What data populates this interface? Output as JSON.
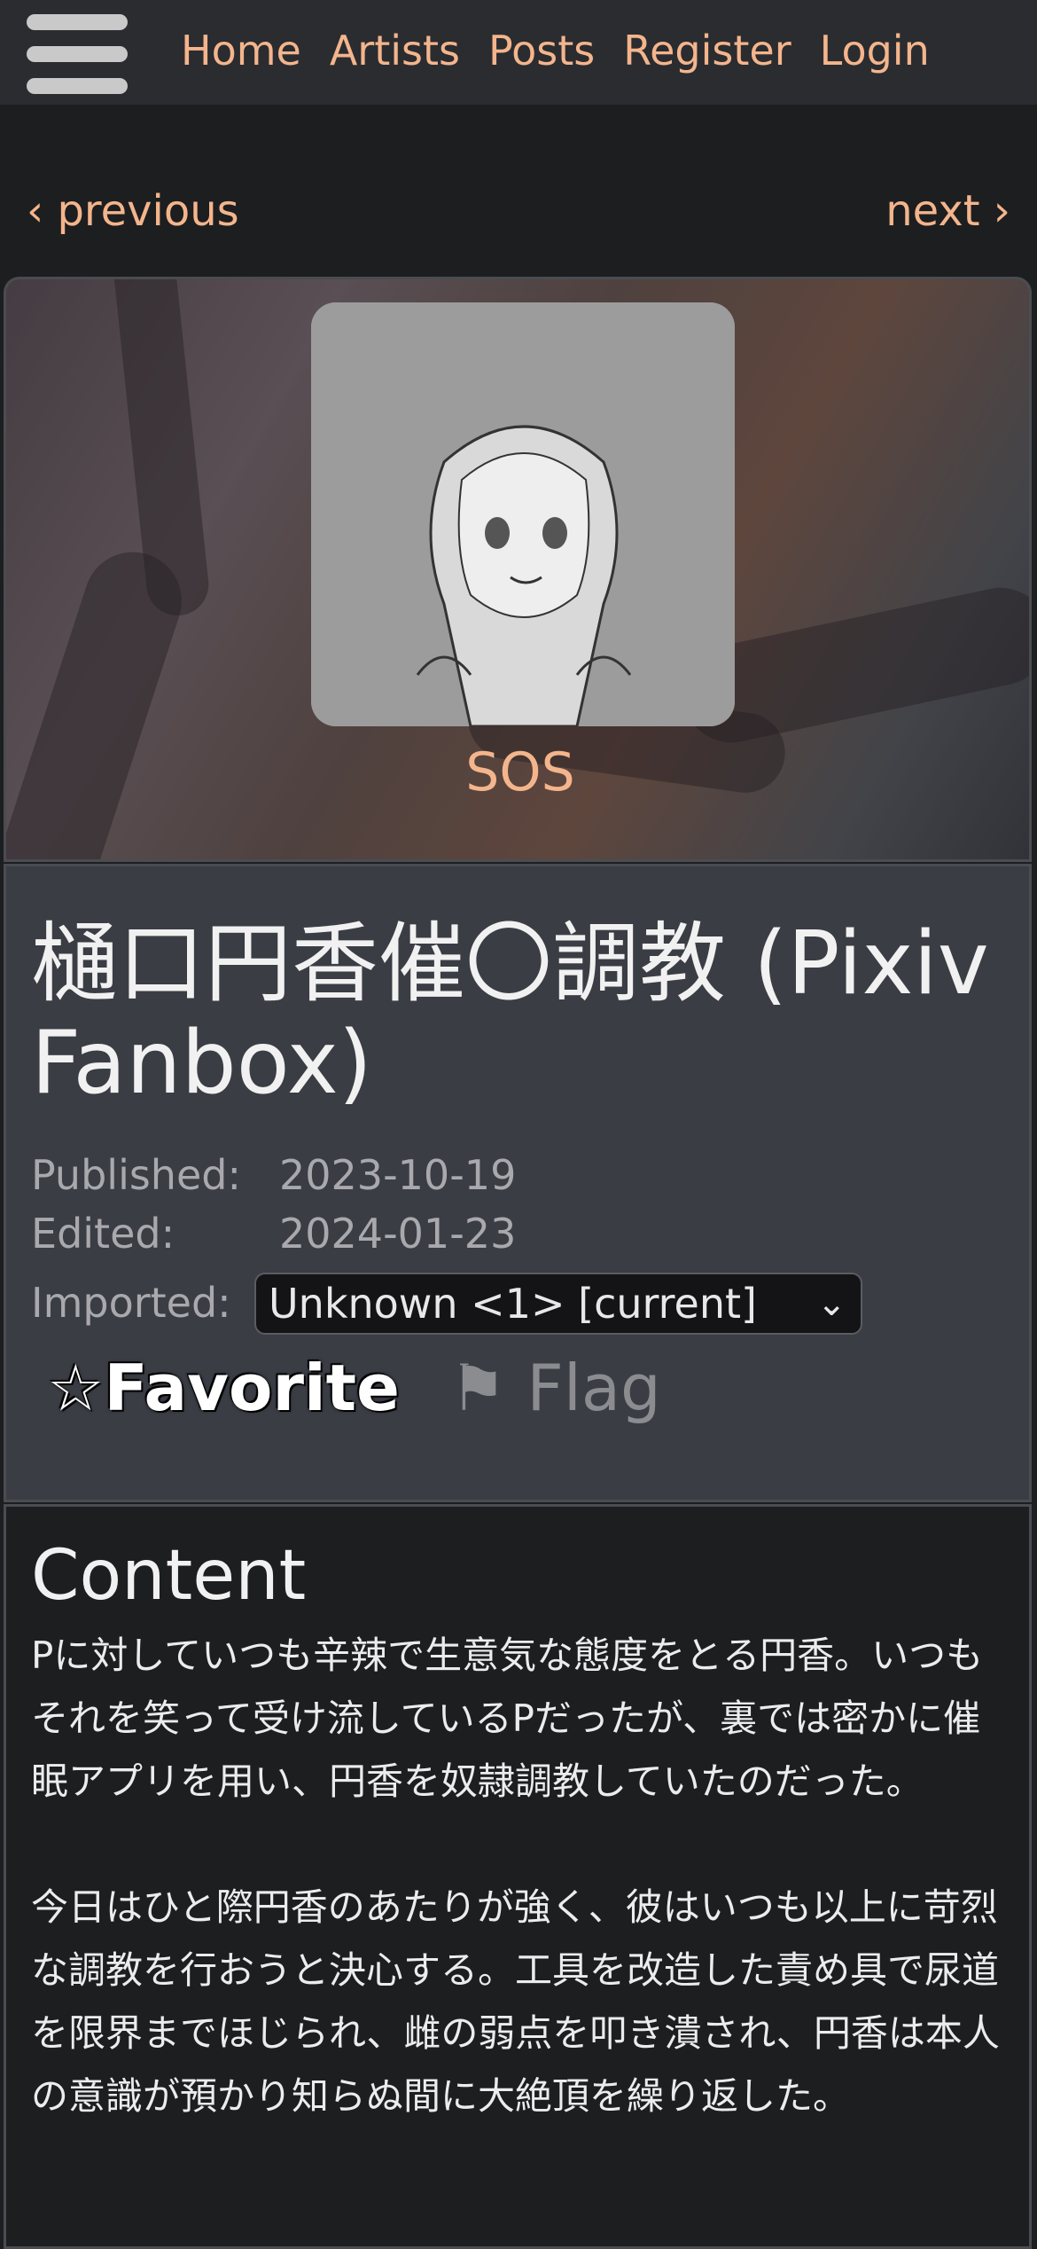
{
  "nav": {
    "items": [
      "Home",
      "Artists",
      "Posts",
      "Register",
      "Login"
    ]
  },
  "pager": {
    "previous": "‹ previous",
    "next": "next ›"
  },
  "artist": {
    "name": "SOS"
  },
  "post": {
    "title": "樋口円香催〇調教 (Pixiv Fanbox)",
    "published_label": "Published:",
    "published_value": "2023-10-19",
    "edited_label": "Edited:",
    "edited_value": "2024-01-23",
    "imported_label": "Imported:",
    "imported_selected": "Unknown <1> [current]",
    "favorite_label": "☆Favorite",
    "flag_label": "⚑ Flag"
  },
  "content": {
    "heading": "Content",
    "paragraphs": [
      "Pに対していつも辛辣で生意気な態度をとる円香。いつもそれを笑って受け流しているPだったが、裏では密かに催眠アプリを用い、円香を奴隷調教していたのだった。",
      "今日はひと際円香のあたりが強く、彼はいつも以上に苛烈な調教を行おうと決心する。工具を改造した責め具で尿道を限界までほじられ、雌の弱点を叩き潰され、円香は本人の意識が預かり知らぬ間に大絶頂を繰り返した。"
    ]
  },
  "colors": {
    "accent": "#f4b58c",
    "background": "#1d1e20",
    "card": "#3b3d45"
  },
  "icons": {
    "menu": "hamburger-menu-icon",
    "chevron": "chevron-down-icon"
  }
}
